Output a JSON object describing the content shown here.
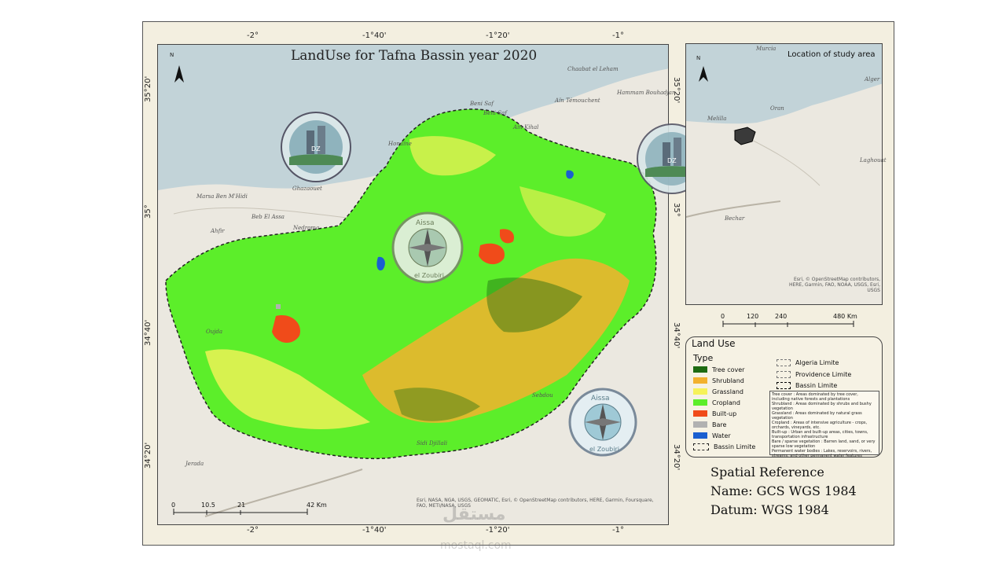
{
  "map": {
    "title": "LandUse for Tafna Bassin year 2020",
    "north_label": "N",
    "top_ticks": [
      "-2°",
      "-1°40'",
      "-1°20'",
      "-1°"
    ],
    "bottom_ticks": [
      "-2°",
      "-1°40'",
      "-1°20'",
      "-1°"
    ],
    "left_ticks": [
      "35°20'",
      "35°",
      "34°40'",
      "34°20'"
    ],
    "right_ticks": [
      "35°20'",
      "35°",
      "34°40'",
      "34°20'"
    ],
    "places": [
      "Beni Saf",
      "Beni Saf",
      "Chaabat el Leham",
      "Aïn Témouchent",
      "Hammam Bouhadjar",
      "Aïn Kihal",
      "Honaïne",
      "Ghazaouet",
      "Marsa Ben M'Hidi",
      "Beb El Assa",
      "Nedroma",
      "Ahfir",
      "Sebdou",
      "Sidi Djillali",
      "Jerada",
      "Oujda"
    ],
    "scale_labels": [
      "0",
      "10.5",
      "21",
      "42 Km"
    ],
    "credits": "Esri, NASA, NGA, USGS, GEOMATIC, Esri, © OpenStreetMap contributors, HERE, Garmin, Foursquare, FAO, METI/NASA, USGS"
  },
  "location": {
    "title": "Location of study area",
    "north_label": "N",
    "places": [
      "Murcia",
      "Alger",
      "Oran",
      "Melilla",
      "Laghouat",
      "Bechar"
    ],
    "scale_labels": [
      "0",
      "120",
      "240",
      "480 Km"
    ],
    "credits": "Esri, © OpenStreetMap contributors, HERE, Garmin, FAO, NOAA, USGS, Esri, USGS"
  },
  "legend": {
    "title": "Land Use",
    "subtitle": "Type",
    "items": [
      {
        "label": "Tree cover",
        "color": "#1e6b12"
      },
      {
        "label": "Shrubland",
        "color": "#f2b12e"
      },
      {
        "label": "Grassland",
        "color": "#f6f259"
      },
      {
        "label": "Cropland",
        "color": "#5cee2a"
      },
      {
        "label": "Built-up",
        "color": "#f04b1a"
      },
      {
        "label": "Bare",
        "color": "#b1b1b1"
      },
      {
        "label": "Water",
        "color": "#1a5fd0"
      },
      {
        "label": "Bassin Limite",
        "color": "none"
      }
    ],
    "limits": [
      "Algeria Limite",
      "Providence Limite",
      "Bassin Limite"
    ],
    "descriptions": [
      "Tree cover : Areas dominated by tree cover, including native forests and plantations",
      "Shrubland : Areas dominated by shrubs and bushy vegetation",
      "Grassland : Areas dominated by natural grass vegetation",
      "Cropland : Areas of intensive agriculture - crops, orchards, vineyards, etc.",
      "Built-up : Urban and built-up areas, cities, towns, transportation infrastructure",
      "Bare / sparse vegetation : Barren land, sand, or very sparse low vegetation",
      "Permanent water bodies : Lakes, reservoirs, rivers, streams, and other permanent water features"
    ]
  },
  "spatial": {
    "line1": "Spatial Reference",
    "line2": "Name: GCS WGS 1984",
    "line3": "Datum: WGS 1984"
  },
  "logos": {
    "badge_text": "DZ",
    "compass_text_top": "Aissa",
    "compass_text_bottom": "el Zoubiri"
  },
  "watermark": {
    "main": "مستقل",
    "sub": "mostaql.com"
  }
}
